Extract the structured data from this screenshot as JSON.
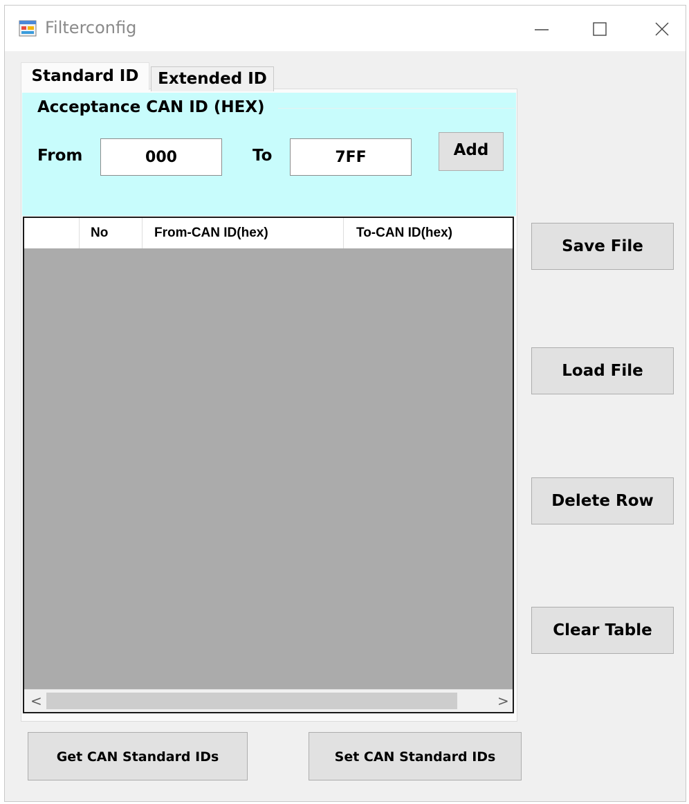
{
  "window": {
    "title": "Filterconfig"
  },
  "tabs": [
    {
      "label": "Standard ID",
      "selected": true
    },
    {
      "label": "Extended ID",
      "selected": false
    }
  ],
  "acceptance": {
    "group_title": "Acceptance CAN ID (HEX)",
    "from_label": "From",
    "from_value": "000",
    "to_label": "To",
    "to_value": "7FF",
    "add_label": "Add"
  },
  "table": {
    "columns": [
      "",
      "No",
      "From-CAN ID(hex)",
      "To-CAN ID(hex)"
    ],
    "rows": [],
    "scroll_left": "<",
    "scroll_right": ">"
  },
  "side_buttons": {
    "save": "Save File",
    "load": "Load File",
    "delete": "Delete Row",
    "clear": "Clear Table"
  },
  "bottom_buttons": {
    "get": "Get CAN Standard IDs",
    "set": "Set CAN Standard IDs"
  },
  "colors": {
    "group_background": "#c8fcfc",
    "grid_background": "#ababab",
    "window_background": "#f0f0f0",
    "button_background": "#e1e1e1"
  },
  "icons": {
    "app": "form-app-icon",
    "minimize": "minimize-icon",
    "maximize": "maximize-icon",
    "close": "close-icon"
  }
}
